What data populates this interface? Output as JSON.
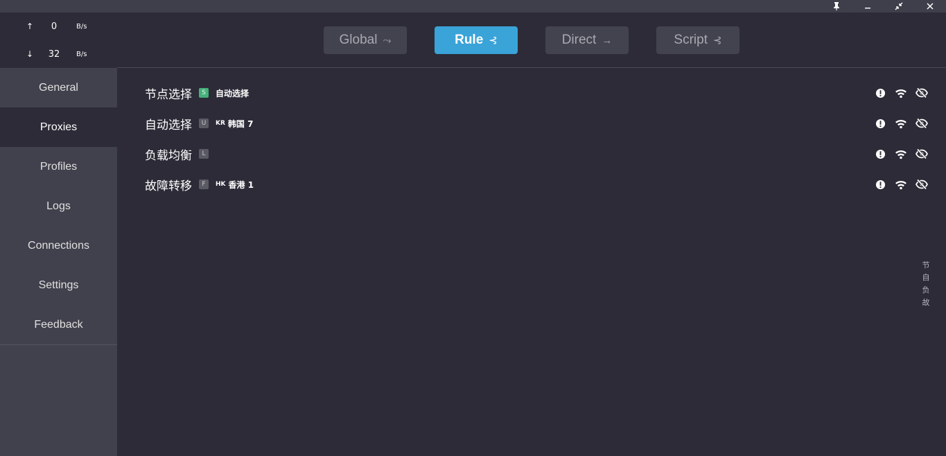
{
  "traffic": {
    "up_arrow": "↑",
    "up_value": "0",
    "up_unit": "B/s",
    "down_arrow": "↓",
    "down_value": "32",
    "down_unit": "B/s"
  },
  "sidebar": {
    "items": [
      {
        "label": "General"
      },
      {
        "label": "Proxies"
      },
      {
        "label": "Profiles"
      },
      {
        "label": "Logs"
      },
      {
        "label": "Connections"
      },
      {
        "label": "Settings"
      },
      {
        "label": "Feedback"
      }
    ],
    "active": "Proxies"
  },
  "modes": [
    {
      "label": "Global",
      "icon": "⤳"
    },
    {
      "label": "Rule",
      "icon": "⊰"
    },
    {
      "label": "Direct",
      "icon": "→"
    },
    {
      "label": "Script",
      "icon": "⊰"
    }
  ],
  "active_mode": "Rule",
  "groups": [
    {
      "name": "节点选择",
      "type": "S",
      "flag": "",
      "current": "自动选择"
    },
    {
      "name": "自动选择",
      "type": "U",
      "flag": "KR",
      "current": "韩国 7"
    },
    {
      "name": "负载均衡",
      "type": "L",
      "flag": "",
      "current": ""
    },
    {
      "name": "故障转移",
      "type": "F",
      "flag": "HK",
      "current": "香港 1"
    }
  ],
  "side_index": [
    "节",
    "自",
    "负",
    "故"
  ],
  "colors": {
    "accent": "#3aa3d8",
    "select_badge": "#46b07a",
    "background": "#2c2b37",
    "sidebar": "#41414d"
  }
}
